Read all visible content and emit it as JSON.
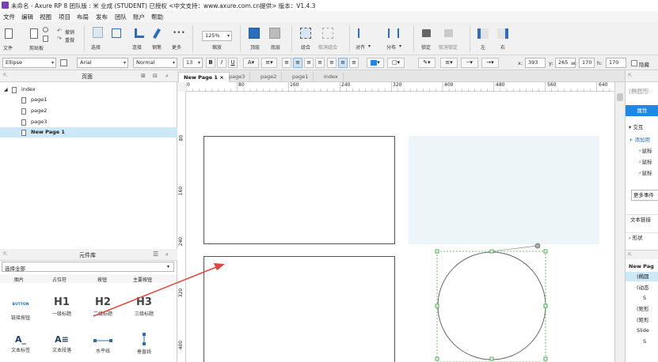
{
  "titlebar": {
    "title": "未命名 - Axure RP 8 团队版 : 米 业成 (STUDENT) 已授权    <中文支持：www.axure.com.cn提供> 版本：V1.4.3"
  },
  "menu": [
    "文件",
    "编辑",
    "视图",
    "项目",
    "布局",
    "发布",
    "团队",
    "账户",
    "帮助"
  ],
  "ribbon": {
    "file": "文件",
    "clipboard": "剪贴板",
    "undo": "撤销",
    "redo": "重做",
    "select": "选择",
    "connect": "连接",
    "pen": "钢笔",
    "more": "更多",
    "zoom_value": "125%",
    "zoom": "缩放",
    "top": "顶层",
    "bottom": "底层",
    "group": "组合",
    "ungroup": "取消组合",
    "align": "对齐",
    "distribute": "分布",
    "lock": "锁定",
    "unlock": "取消锁定",
    "left": "左",
    "right": "右"
  },
  "format": {
    "style": "Ellipse",
    "font": "Arial",
    "weight": "Normal",
    "size": "13",
    "x_label": "x:",
    "x_value": "393",
    "y_label": "y:",
    "y_value": "265",
    "w_label": "w:",
    "w_value": "170",
    "h_label": "h:",
    "h_value": "170",
    "hidden": "隐藏"
  },
  "pages_panel": {
    "title": "页面",
    "root": "index",
    "pages": [
      "page1",
      "page2",
      "page3",
      "New Page 1"
    ],
    "selected_index": 3
  },
  "library_panel": {
    "title": "元件库",
    "filter": "选择全部",
    "row1": [
      "图片",
      "占位符",
      "按钮",
      "主要按钮"
    ],
    "row2": [
      {
        "glyph": "BUTTON",
        "label": "链接按钮"
      },
      {
        "glyph": "H1",
        "label": "一级标题"
      },
      {
        "glyph": "H2",
        "label": "二级标题"
      },
      {
        "glyph": "H3",
        "label": "三级标题"
      }
    ],
    "row3": [
      {
        "glyph": "A_",
        "label": "文本标签"
      },
      {
        "glyph": "A≡",
        "label": "文本段落"
      },
      {
        "glyph": "",
        "label": "水平线"
      },
      {
        "glyph": "",
        "label": "垂直线"
      }
    ]
  },
  "tabs": [
    "New Page 1",
    "page3",
    "page2",
    "page1",
    "index"
  ],
  "ruler": {
    "h": [
      "0",
      "80",
      "160",
      "240",
      "320",
      "400",
      "480",
      "560",
      "640"
    ],
    "v": [
      "80",
      "160",
      "240",
      "320",
      "400"
    ]
  },
  "right_panel": {
    "shape_name": "(椭圆形",
    "tab_properties": "属性",
    "interactions": "交互",
    "add_case": "添加用",
    "events": [
      "鼠标",
      "鼠标",
      "鼠标"
    ],
    "more_events": "更多事件",
    "text_link": "文本链接",
    "shape": "形状",
    "outline": [
      "New Pag",
      "(椭圆",
      "(动态",
      "S",
      "(矩形",
      "(矩形",
      "Slide",
      "S"
    ]
  },
  "colors": {
    "accent": "#1e88e5",
    "selection": "#cde8f7",
    "arrow": "#e0443a",
    "handle": "#46b04a"
  }
}
